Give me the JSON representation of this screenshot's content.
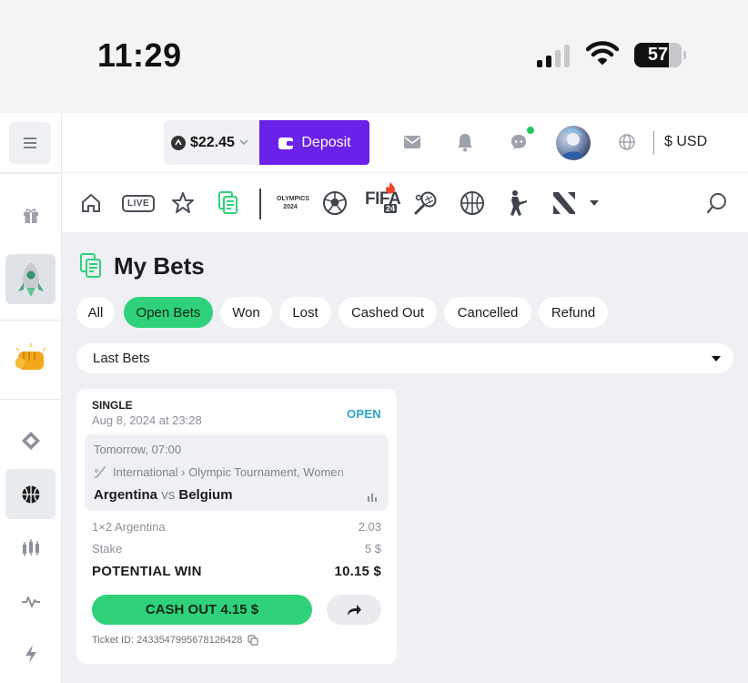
{
  "status_bar": {
    "time": "11:29",
    "battery": "57"
  },
  "header": {
    "balance": "$22.45",
    "deposit_label": "Deposit",
    "currency": "$ USD"
  },
  "my_bets": {
    "title": "My Bets",
    "filters": [
      "All",
      "Open Bets",
      "Won",
      "Lost",
      "Cashed Out",
      "Cancelled",
      "Refund"
    ],
    "active_filter": "Open Bets",
    "period_select": "Last Bets"
  },
  "bet": {
    "type": "SINGLE",
    "date": "Aug 8, 2024 at 23:28",
    "status": "OPEN",
    "event_time": "Tomorrow, 07:00",
    "league": "International › Olympic Tournament, Women",
    "team_home": "Argentina",
    "vs": "vs",
    "team_away": "Belgium",
    "selection": "1×2 Argentina",
    "odds": "2.03",
    "stake_label": "Stake",
    "stake": "5 $",
    "potential_win_label": "POTENTIAL WIN",
    "potential_win": "10.15 $",
    "cashout_label": "CASH OUT 4.15 $",
    "ticket_id": "Ticket ID: 2433547995678126428"
  },
  "nav_badges": {
    "olympics": "OLYMPICS 2024",
    "fifa": "FIFA",
    "fifa_year": "24",
    "live": "LIVE"
  },
  "colors": {
    "accent_green": "#2fd27a",
    "deposit_purple": "#6b21e8",
    "status_open": "#2aa5c9"
  }
}
